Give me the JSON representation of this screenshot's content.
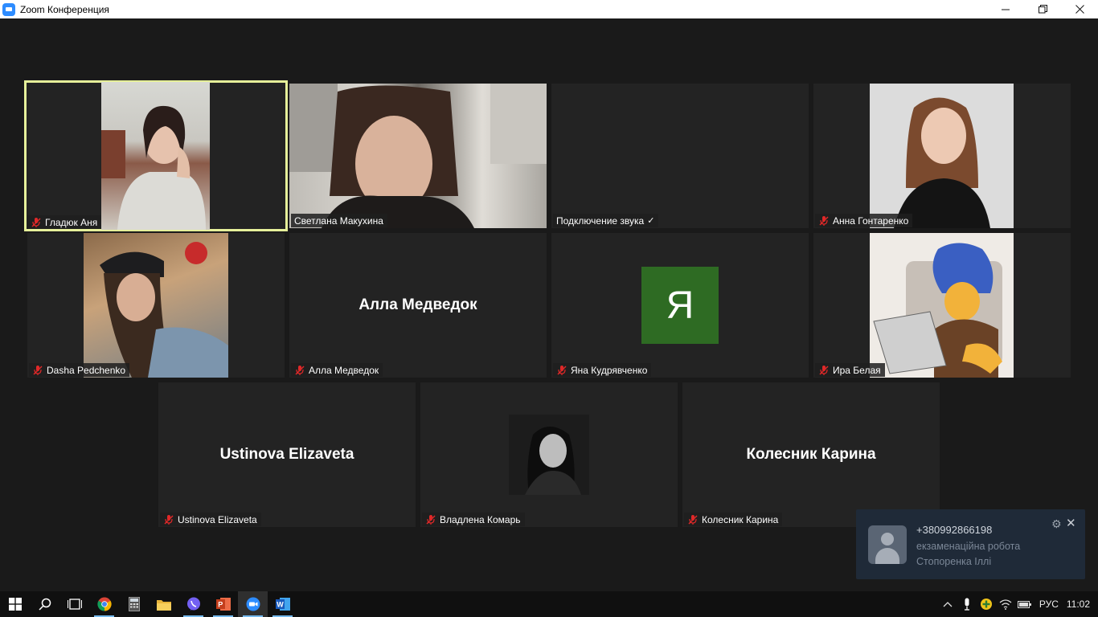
{
  "window": {
    "title": "Zoom Конференция"
  },
  "participants": [
    {
      "name": "Гладюк Аня",
      "muted": true,
      "active": true
    },
    {
      "name": "Светлана Макухина",
      "muted": false
    },
    {
      "name": "Подключение звука",
      "muted": false,
      "connecting": true
    },
    {
      "name": "Анна Гонтаренко",
      "muted": true
    },
    {
      "name": "Dasha Pedchenko",
      "muted": true
    },
    {
      "name": "Алла Медведок",
      "muted": true,
      "display_name": "Алла Медведок"
    },
    {
      "name": "Яна Кудрявченко",
      "muted": true,
      "avatar_letter": "Я",
      "avatar_color": "#2e6b23"
    },
    {
      "name": "Ира Белая",
      "muted": true
    },
    {
      "name": "Ustinova Elizaveta",
      "muted": true,
      "display_name": "Ustinova Elizaveta"
    },
    {
      "name": "Владлена Комарь",
      "muted": true
    },
    {
      "name": "Колесник Карина",
      "muted": true,
      "display_name": "Колесник Карина"
    }
  ],
  "notification": {
    "sender": "+380992866198",
    "message": "екзаменаційна робота Стопоренка Іллі"
  },
  "taskbar": {
    "language": "РУС",
    "time": "11:02"
  },
  "colors": {
    "active_speaker_border": "#e6f09a",
    "mute_red": "#e02828",
    "zoom_blue": "#2d8cff"
  }
}
